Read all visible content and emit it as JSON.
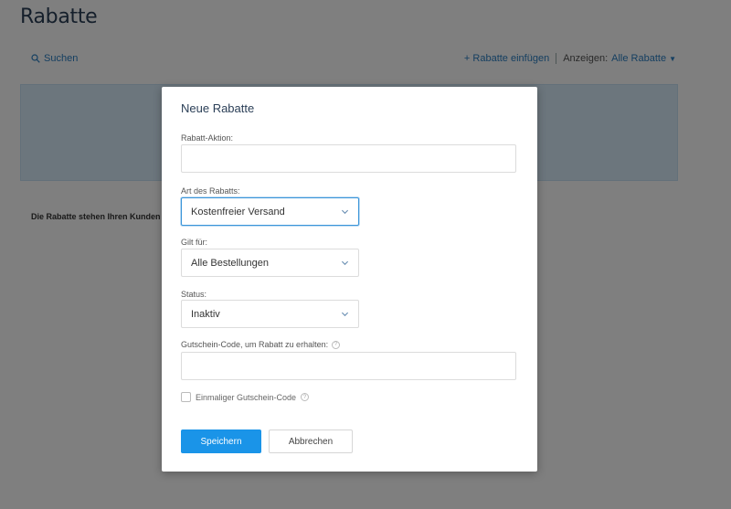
{
  "page": {
    "title": "Rabatte",
    "search_label": "Suchen",
    "add_discount_label": "+ Rabatte einfügen",
    "show_label": "Anzeigen:",
    "show_value": "Alle Rabatte",
    "note_text": "Die Rabatte stehen Ihren Kunden"
  },
  "modal": {
    "title": "Neue Rabatte",
    "action": {
      "label": "Rabatt-Aktion:",
      "value": "",
      "placeholder": ""
    },
    "type": {
      "label": "Art des Rabatts:",
      "value": "Kostenfreier Versand"
    },
    "applies_to": {
      "label": "Gilt für:",
      "value": "Alle Bestellungen"
    },
    "status": {
      "label": "Status:",
      "value": "Inaktiv"
    },
    "coupon": {
      "label": "Gutschein-Code, um Rabatt zu erhalten:",
      "value": "",
      "placeholder": ""
    },
    "single_use": {
      "label": "Einmaliger Gutschein-Code",
      "checked": false
    },
    "save_label": "Speichern",
    "cancel_label": "Abbrechen"
  },
  "colors": {
    "primary": "#1a94e8",
    "link": "#2a7ec2",
    "panel": "#d9ecfa",
    "heading": "#2b3f57"
  },
  "icons": [
    "search-icon",
    "chevron-down-icon",
    "help-icon",
    "caret-down-icon"
  ]
}
